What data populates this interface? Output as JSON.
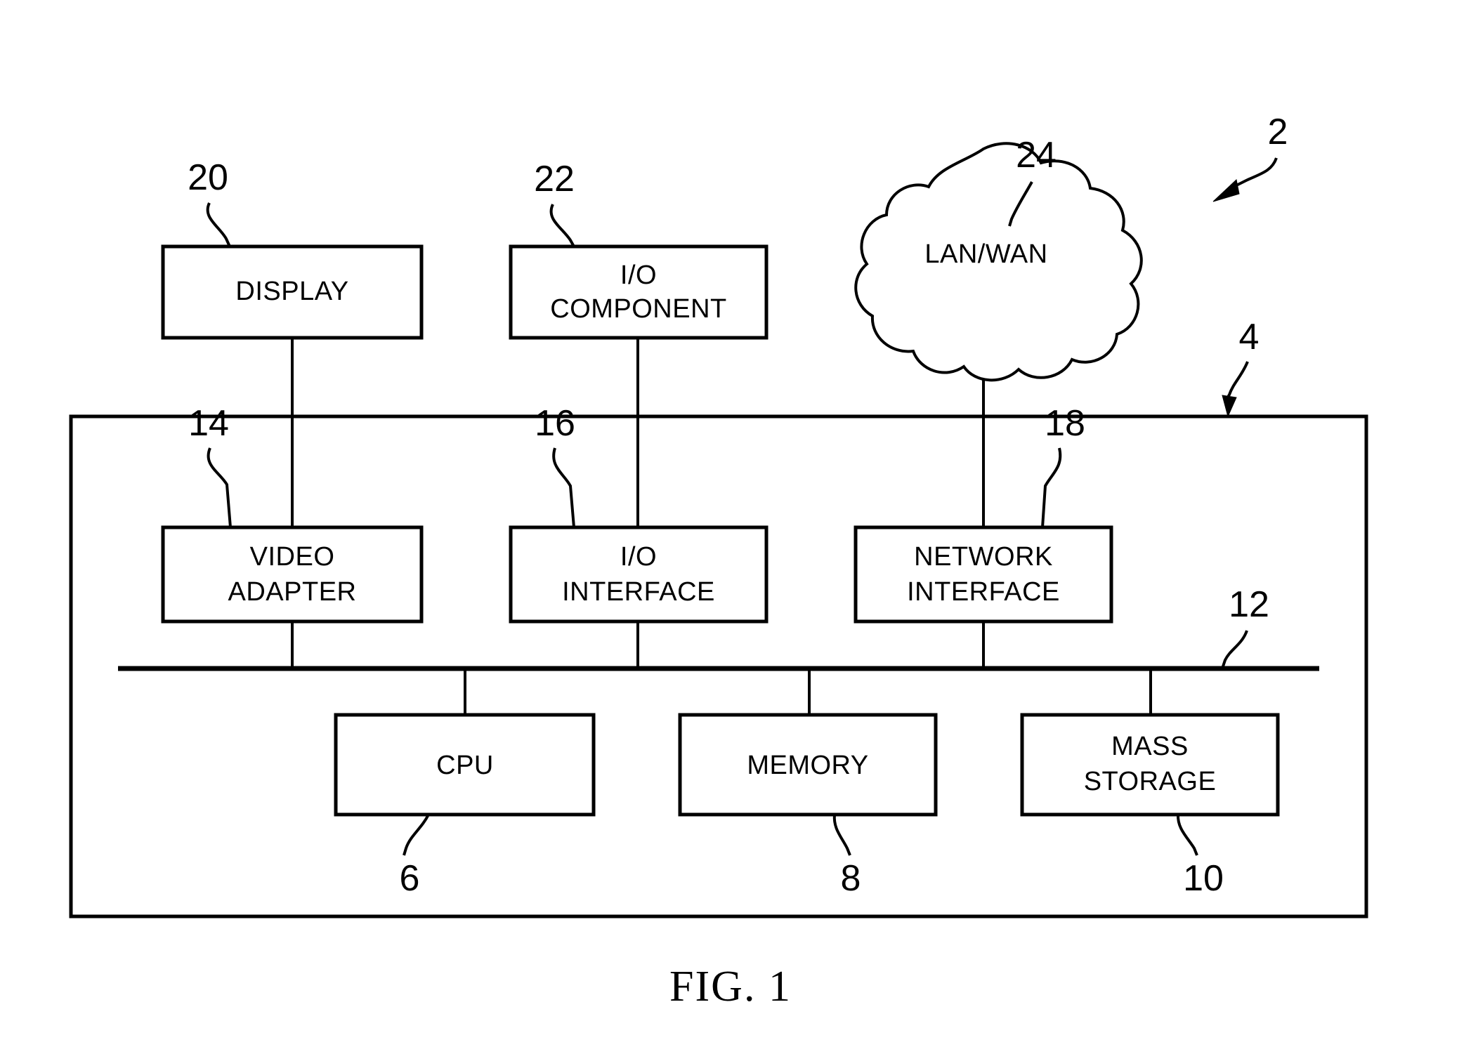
{
  "figure": {
    "caption": "FIG. 1",
    "title": "Computer system block diagram"
  },
  "external_blocks": [
    {
      "id": "display",
      "label_lines": [
        "DISPLAY"
      ],
      "ref": "20"
    },
    {
      "id": "io-component",
      "label_lines": [
        "I/O",
        "COMPONENT"
      ],
      "ref": "22"
    },
    {
      "id": "lan-wan",
      "label_lines": [
        "LAN/WAN"
      ],
      "ref": "24"
    }
  ],
  "interface_blocks": [
    {
      "id": "video-adapter",
      "label_lines": [
        "VIDEO",
        "ADAPTER"
      ],
      "ref": "14"
    },
    {
      "id": "io-interface",
      "label_lines": [
        "I/O",
        "INTERFACE"
      ],
      "ref": "16"
    },
    {
      "id": "network-interface",
      "label_lines": [
        "NETWORK",
        "INTERFACE"
      ],
      "ref": "18"
    }
  ],
  "core_blocks": [
    {
      "id": "cpu",
      "label_lines": [
        "CPU"
      ],
      "ref": "6"
    },
    {
      "id": "memory",
      "label_lines": [
        "MEMORY"
      ],
      "ref": "8"
    },
    {
      "id": "mass-storage",
      "label_lines": [
        "MASS",
        "STORAGE"
      ],
      "ref": "10"
    }
  ],
  "structural_refs": {
    "system": "2",
    "computer": "4",
    "bus": "12"
  },
  "labels": {
    "display": "DISPLAY",
    "io_component_l1": "I/O",
    "io_component_l2": "COMPONENT",
    "lan_wan": "LAN/WAN",
    "video_adapter_l1": "VIDEO",
    "video_adapter_l2": "ADAPTER",
    "io_interface_l1": "I/O",
    "io_interface_l2": "INTERFACE",
    "network_interface_l1": "NETWORK",
    "network_interface_l2": "INTERFACE",
    "cpu": "CPU",
    "memory": "MEMORY",
    "mass_storage_l1": "MASS",
    "mass_storage_l2": "STORAGE",
    "ref_2": "2",
    "ref_4": "4",
    "ref_6": "6",
    "ref_8": "8",
    "ref_10": "10",
    "ref_12": "12",
    "ref_14": "14",
    "ref_16": "16",
    "ref_18": "18",
    "ref_20": "20",
    "ref_22": "22",
    "ref_24": "24",
    "fig_caption": "FIG. 1"
  },
  "colors": {
    "stroke": "#000000",
    "background": "#ffffff"
  }
}
